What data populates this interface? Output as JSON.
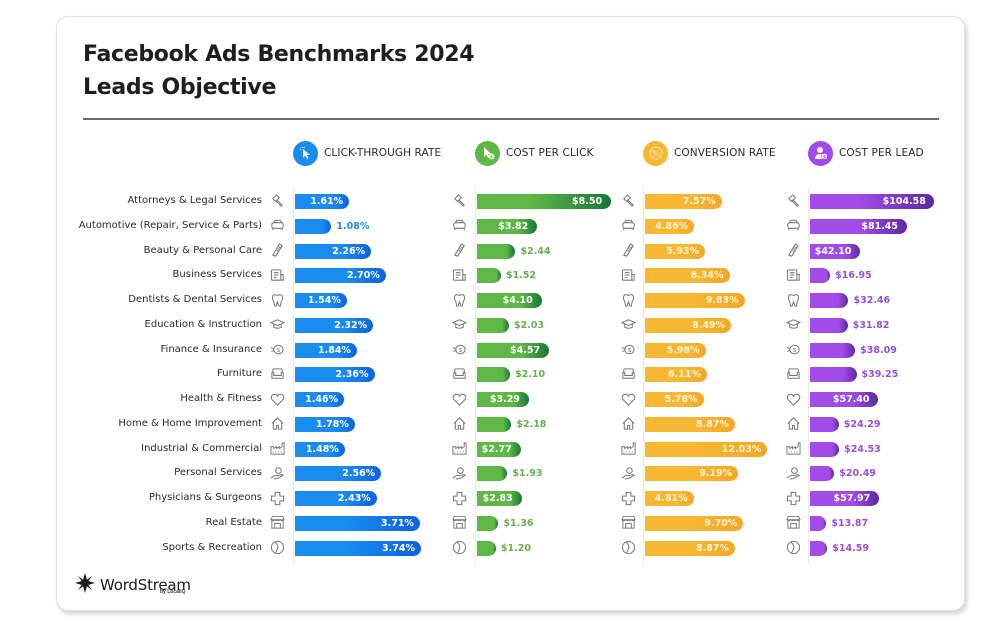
{
  "header": {
    "title_line1": "Facebook Ads Benchmarks 2024",
    "title_line2": "Leads Objective"
  },
  "columns": [
    {
      "key": "ctr",
      "label": "CLICK-THROUGH RATE",
      "icon": "cursor-click-icon",
      "color": "#1a8cf0",
      "color_dark": "#0d63e0"
    },
    {
      "key": "cpc",
      "label": "COST PER CLICK",
      "icon": "cursor-dollar-icon",
      "color": "#5fb845",
      "color_dark": "#17773a"
    },
    {
      "key": "cvr",
      "label": "CONVERSION RATE",
      "icon": "percent-icon",
      "color": "#f7b733",
      "color_dark": "#f5a623"
    },
    {
      "key": "cpl",
      "label": "COST PER LEAD",
      "icon": "user-dollar-icon",
      "color": "#a24be8",
      "color_dark": "#5c2a9e"
    }
  ],
  "chart_data": {
    "type": "bar",
    "title": "Facebook Ads Benchmarks 2024 — Leads Objective",
    "orientation": "horizontal",
    "categories": [
      "Attorneys & Legal Services",
      "Automotive (Repair, Service & Parts)",
      "Beauty & Personal Care",
      "Business Services",
      "Dentists & Dental Services",
      "Education & Instruction",
      "Finance & Insurance",
      "Furniture",
      "Health & Fitness",
      "Home & Home Improvement",
      "Industrial & Commercial",
      "Personal Services",
      "Physicians & Surgeons",
      "Real Estate",
      "Sports & Recreation"
    ],
    "category_icons": [
      "gavel-icon",
      "car-icon",
      "comb-icon",
      "document-icon",
      "tooth-icon",
      "graduation-cap-icon",
      "piggy-bank-icon",
      "armchair-icon",
      "heart-icon",
      "house-icon",
      "factory-icon",
      "hand-heart-icon",
      "medical-cross-icon",
      "storefront-icon",
      "ball-icon"
    ],
    "series": [
      {
        "name": "Click-Through Rate",
        "unit": "%",
        "values": [
          1.61,
          1.08,
          2.26,
          2.7,
          1.54,
          2.32,
          1.84,
          2.36,
          1.46,
          1.78,
          1.48,
          2.56,
          2.43,
          3.71,
          3.74
        ],
        "labels": [
          "1.61%",
          "1.08%",
          "2.26%",
          "2.70%",
          "1.54%",
          "2.32%",
          "1.84%",
          "2.36%",
          "1.46%",
          "1.78%",
          "1.48%",
          "2.56%",
          "2.43%",
          "3.71%",
          "3.74%"
        ]
      },
      {
        "name": "Cost Per Click",
        "unit": "$",
        "values": [
          8.5,
          3.82,
          2.44,
          1.52,
          4.1,
          2.03,
          4.57,
          2.1,
          3.29,
          2.18,
          2.77,
          1.93,
          2.83,
          1.36,
          1.2
        ],
        "labels": [
          "$8.50",
          "$3.82",
          "$2.44",
          "$1.52",
          "$4.10",
          "$2.03",
          "$4.57",
          "$2.10",
          "$3.29",
          "$2.18",
          "$2.77",
          "$1.93",
          "$2.83",
          "$1.36",
          "$1.20"
        ]
      },
      {
        "name": "Conversion Rate",
        "unit": "%",
        "values": [
          7.57,
          4.86,
          5.93,
          8.34,
          9.83,
          8.49,
          5.98,
          6.11,
          5.78,
          8.87,
          12.03,
          9.19,
          4.81,
          9.7,
          8.87
        ],
        "labels": [
          "7.57%",
          "4.86%",
          "5.93%",
          "8.34%",
          "9.83%",
          "8.49%",
          "5.98%",
          "6.11%",
          "5.78%",
          "8.87%",
          "12.03%",
          "9.19%",
          "4.81%",
          "9.70%",
          "8.87%"
        ]
      },
      {
        "name": "Cost Per Lead",
        "unit": "$",
        "values": [
          104.58,
          81.45,
          42.1,
          16.95,
          32.46,
          31.82,
          38.09,
          39.25,
          57.4,
          24.29,
          24.53,
          20.49,
          57.97,
          13.87,
          14.59
        ],
        "labels": [
          "$104.58",
          "$81.45",
          "$42.10",
          "$16.95",
          "$32.46",
          "$31.82",
          "$38.09",
          "$39.25",
          "$57.40",
          "$24.29",
          "$24.53",
          "$20.49",
          "$57.97",
          "$13.87",
          "$14.59"
        ]
      }
    ],
    "xlim": [
      [
        0,
        3.74
      ],
      [
        0,
        8.5
      ],
      [
        0,
        12.03
      ],
      [
        0,
        104.58
      ]
    ],
    "grid": false,
    "legend": "top"
  },
  "footer": {
    "brand": "WordStream",
    "brand_sub": "by LocaliQ"
  }
}
